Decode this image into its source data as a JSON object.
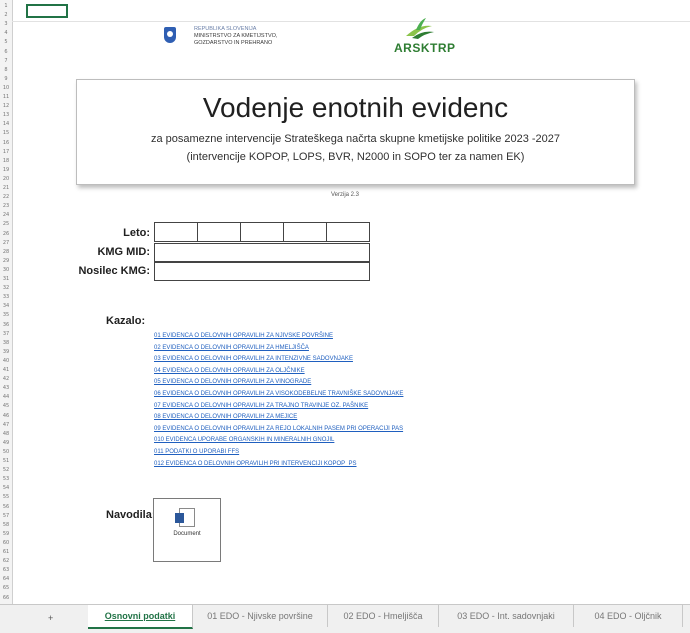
{
  "header": {
    "ministry_lines": [
      "REPUBLIKA SLOVENIJA",
      "MINISTRSTVO ZA KMETIJSTVO,",
      "GOZDARSTVO IN PREHRANO"
    ],
    "agency_logo_text": "ARSKTRP"
  },
  "title": {
    "main": "Vodenje enotnih evidenc",
    "subtitle1": "za posamezne intervencije Strateškega načrta skupne kmetijske politike 2023 -2027",
    "subtitle2": "(intervencije KOPOP, LOPS, BVR, N2000 in SOPO ter za namen EK)"
  },
  "version": "Verzija 2.3",
  "form": {
    "leto_label": "Leto:",
    "kmg_mid_label": "KMG MID:",
    "nosilec_label": "Nosilec KMG:"
  },
  "kazalo": {
    "label": "Kazalo:",
    "links": [
      "01 EVIDENCA O DELOVNIH OPRAVILIH ZA NJIVSKE POVRŠINE",
      "02 EVIDENCA O DELOVNIH OPRAVILIH ZA HMELJIŠČA",
      "03 EVIDENCA O DELOVNIH OPRAVILIH ZA INTENZIVNE SADOVNJAKE",
      "04 EVIDENCA O DELOVNIH OPRAVILIH ZA OLJČNIKE",
      "05 EVIDENCA O DELOVNIH OPRAVILIH ZA VINOGRADE",
      "06 EVIDENCA O DELOVNIH OPRAVILIH ZA VISOKODEBELNE TRAVNIŠKE SADOVNJAKE",
      "07 EVIDENCA O DELOVNIH OPRAVILIH ZA TRAJNO TRAVINJE OZ. PAŠNIKE",
      "08 EVIDENCA O DELOVNIH OPRAVILIH ZA MEJICE",
      "09 EVIDENCA O DELOVNIH OPRAVILIH ZA REJO LOKALNIH PASEM PRI OPERACIJI PAS",
      "010 EVIDENCA UPORABE ORGANSKIH IN MINERALNIH GNOJIL",
      "011 PODATKI O UPORABI FFS",
      "012 EVIDENCA O DELOVNIH OPRAVILIH PRI INTERVENCIJI KOPOP_PS"
    ]
  },
  "navodila": {
    "label": "Navodila:",
    "object_label": "Document"
  },
  "tabs": [
    {
      "label": "Osnovni podatki",
      "active": true
    },
    {
      "label": "01 EDO - Njivske površine",
      "active": false
    },
    {
      "label": "02 EDO - Hmeljišča",
      "active": false
    },
    {
      "label": "03 EDO - Int. sadovnjaki",
      "active": false
    },
    {
      "label": "04 EDO - Oljčnik",
      "active": false
    }
  ],
  "tab_nav": "+"
}
